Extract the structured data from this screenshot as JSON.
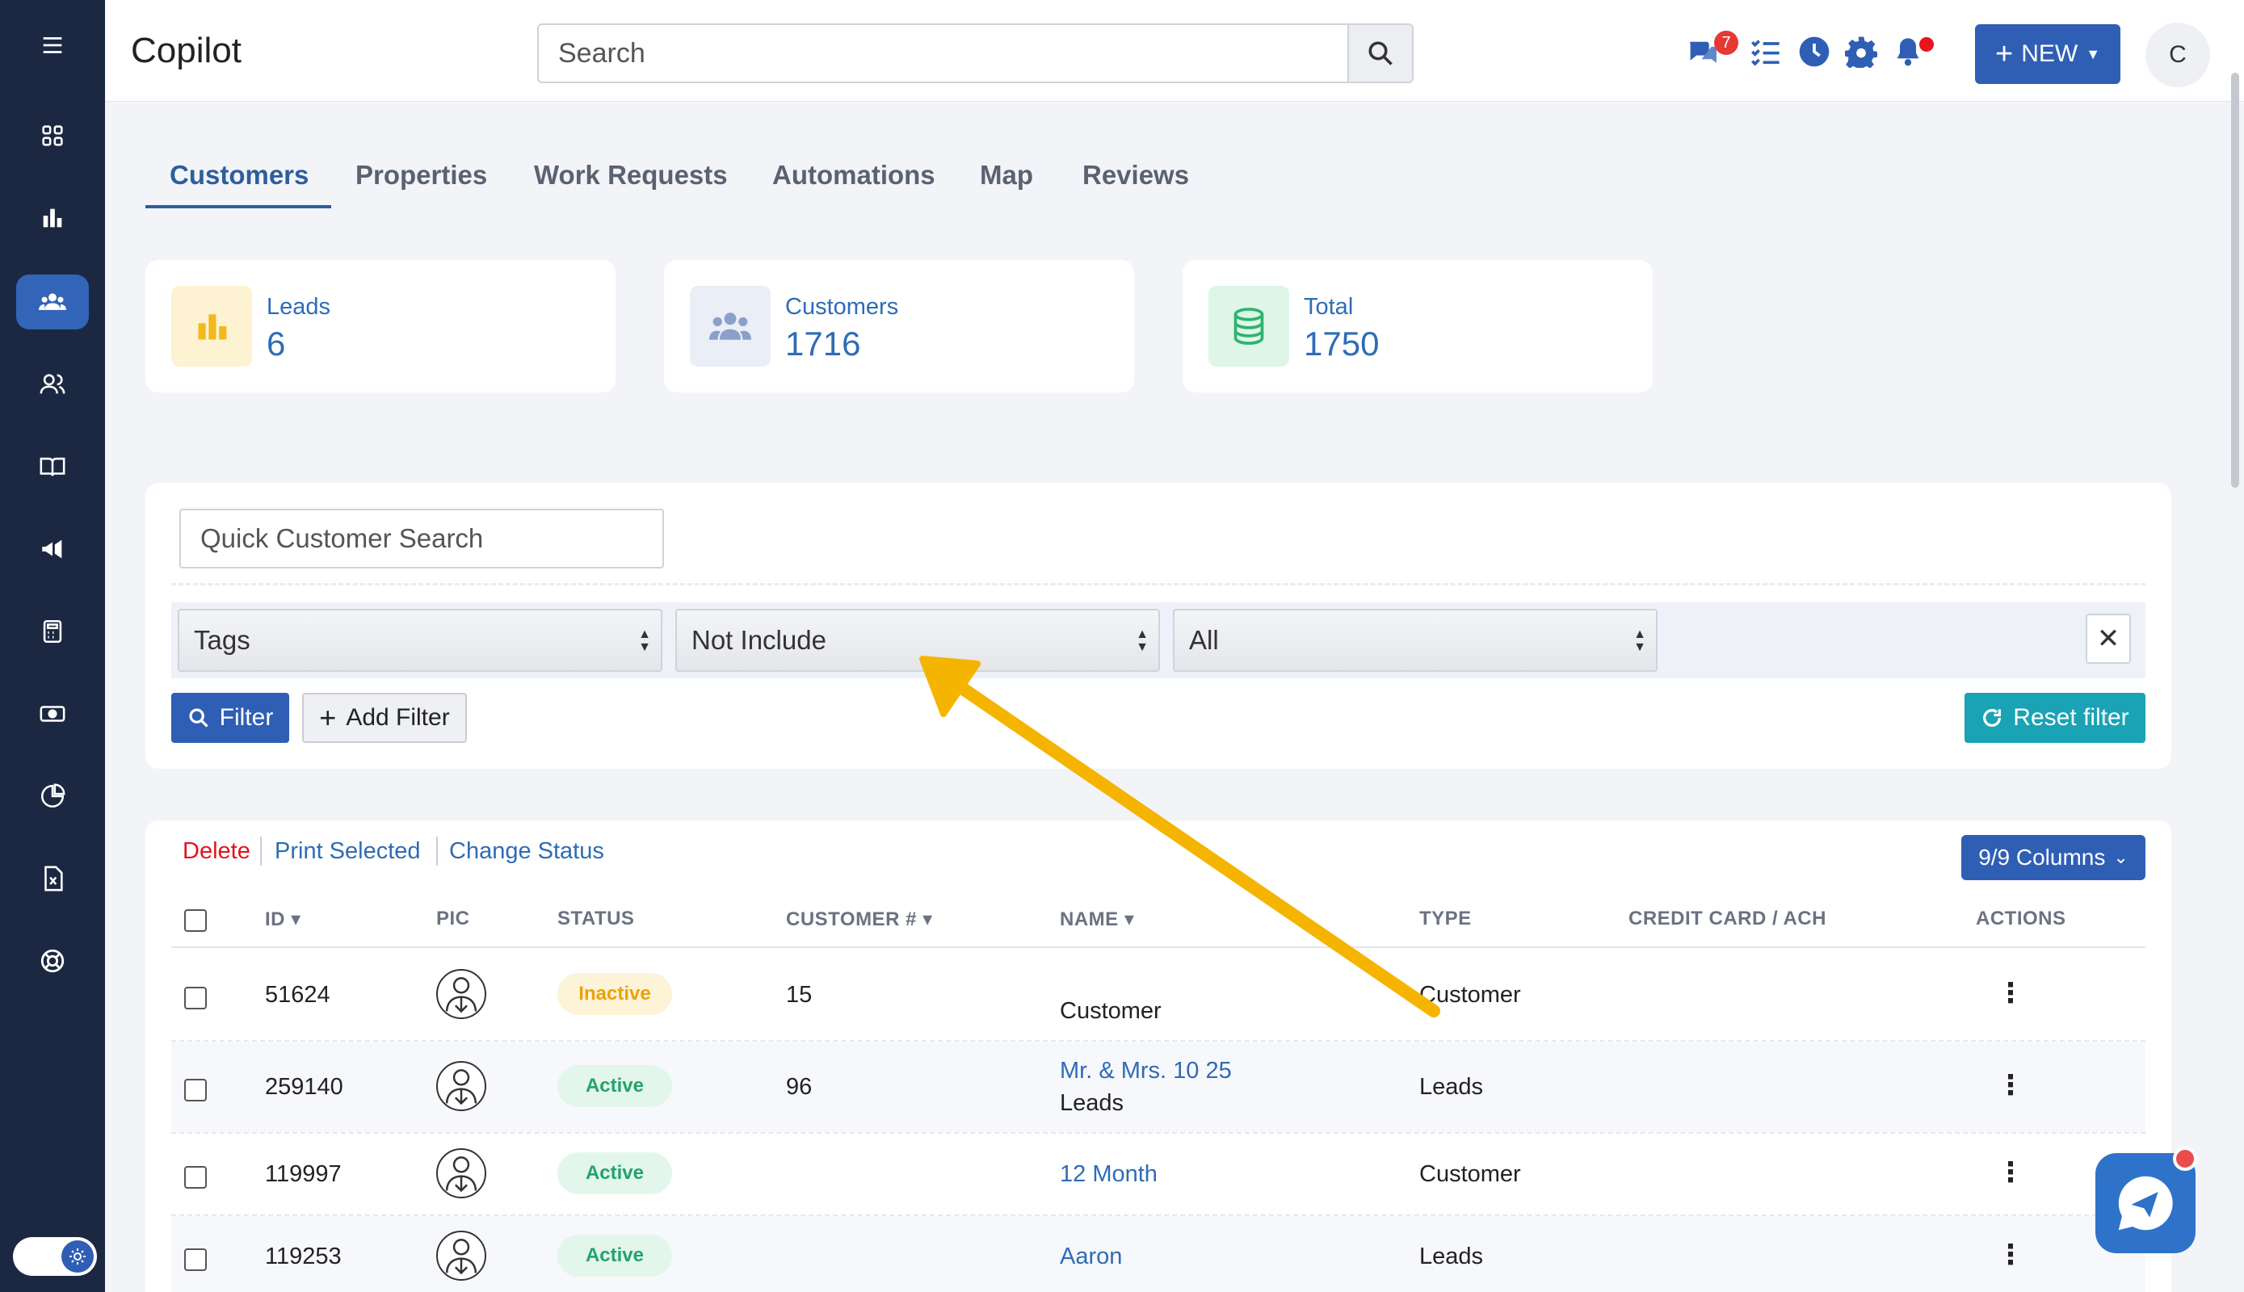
{
  "app": {
    "title": "Copilot"
  },
  "header": {
    "search_placeholder": "Search",
    "chat_badge": "7",
    "new_button": "NEW",
    "avatar_letter": "C"
  },
  "sidebar": {
    "icons": [
      "menu-icon",
      "dashboard-icon",
      "reports-icon",
      "customers-icon",
      "team-icon",
      "book-icon",
      "marketing-icon",
      "calculator-icon",
      "payments-icon",
      "analytics-icon",
      "excel-icon",
      "support-icon"
    ],
    "active": "customers-icon"
  },
  "tabs": [
    "Customers",
    "Properties",
    "Work Requests",
    "Automations",
    "Map",
    "Reviews"
  ],
  "stats": [
    {
      "label": "Leads",
      "value": "6",
      "icon": "bar-chart-icon",
      "color": "#f2b81c"
    },
    {
      "label": "Customers",
      "value": "1716",
      "icon": "people-icon",
      "color": "#8aa0c8"
    },
    {
      "label": "Total",
      "value": "1750",
      "icon": "database-icon",
      "color": "#2fb36f"
    }
  ],
  "filters": {
    "quick_search_placeholder": "Quick Customer Search",
    "field": "Tags",
    "operator": "Not Include",
    "value": "All",
    "filter_button": "Filter",
    "add_filter_button": "Add Filter",
    "reset_button": "Reset filter"
  },
  "bulk_actions": {
    "delete": "Delete",
    "print": "Print Selected",
    "change_status": "Change Status"
  },
  "columns_button": "9/9 Columns",
  "table": {
    "headers": [
      "ID",
      "PIC",
      "STATUS",
      "CUSTOMER #",
      "NAME",
      "TYPE",
      "CREDIT CARD / ACH",
      "ACTIONS"
    ],
    "rows": [
      {
        "id": "51624",
        "status": "Inactive",
        "customer_no": "15",
        "name_link": "",
        "name_sub": "Customer",
        "type": "Customer"
      },
      {
        "id": "259140",
        "status": "Active",
        "customer_no": "96",
        "name_link": "Mr. & Mrs. 10 25",
        "name_sub": "Leads",
        "type": "Leads"
      },
      {
        "id": "119997",
        "status": "Active",
        "customer_no": "",
        "name_link": "12 Month",
        "name_sub": "",
        "type": "Customer"
      },
      {
        "id": "119253",
        "status": "Active",
        "customer_no": "",
        "name_link": "Aaron",
        "name_sub": "",
        "type": "Leads"
      }
    ]
  },
  "colors": {
    "accent": "#2f5fb4",
    "sidebar": "#1c2841",
    "annotation_arrow": "#f5b400"
  }
}
